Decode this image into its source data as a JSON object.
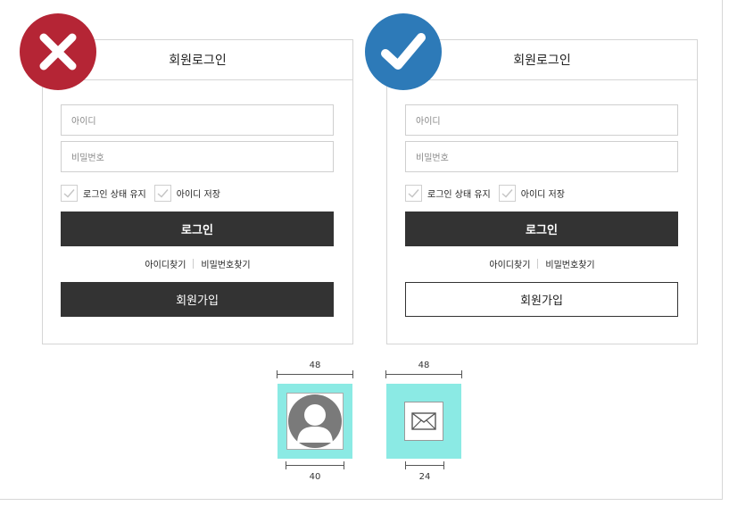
{
  "panels": [
    {
      "variant": "incorrect",
      "title": "회원로그인",
      "id_placeholder": "아이디",
      "pw_placeholder": "비밀번호",
      "keep_login_label": "로그인 상태 유지",
      "save_id_label": "아이디 저장",
      "login_label": "로그인",
      "find_id_label": "아이디찾기",
      "find_pw_label": "비밀번호찾기",
      "join_label": "회원가입",
      "join_style": "filled"
    },
    {
      "variant": "correct",
      "title": "회원로그인",
      "id_placeholder": "아이디",
      "pw_placeholder": "비밀번호",
      "keep_login_label": "로그인 상태 유지",
      "save_id_label": "아이디 저장",
      "login_label": "로그인",
      "find_id_label": "아이디찾기",
      "find_pw_label": "비밀번호찾기",
      "join_label": "회원가입",
      "join_style": "outline"
    }
  ],
  "badges": {
    "incorrect": {
      "icon": "x-icon",
      "color": "#b52535"
    },
    "correct": {
      "icon": "checkmark-icon",
      "color": "#2d7ab8"
    }
  },
  "icon_specs": {
    "avatar": {
      "icon": "user-avatar-icon",
      "outer_label": "48",
      "inner_label": "40"
    },
    "mail": {
      "icon": "mail-icon",
      "outer_label": "48",
      "inner_label": "24"
    },
    "swatch_color": "#8beae4"
  }
}
